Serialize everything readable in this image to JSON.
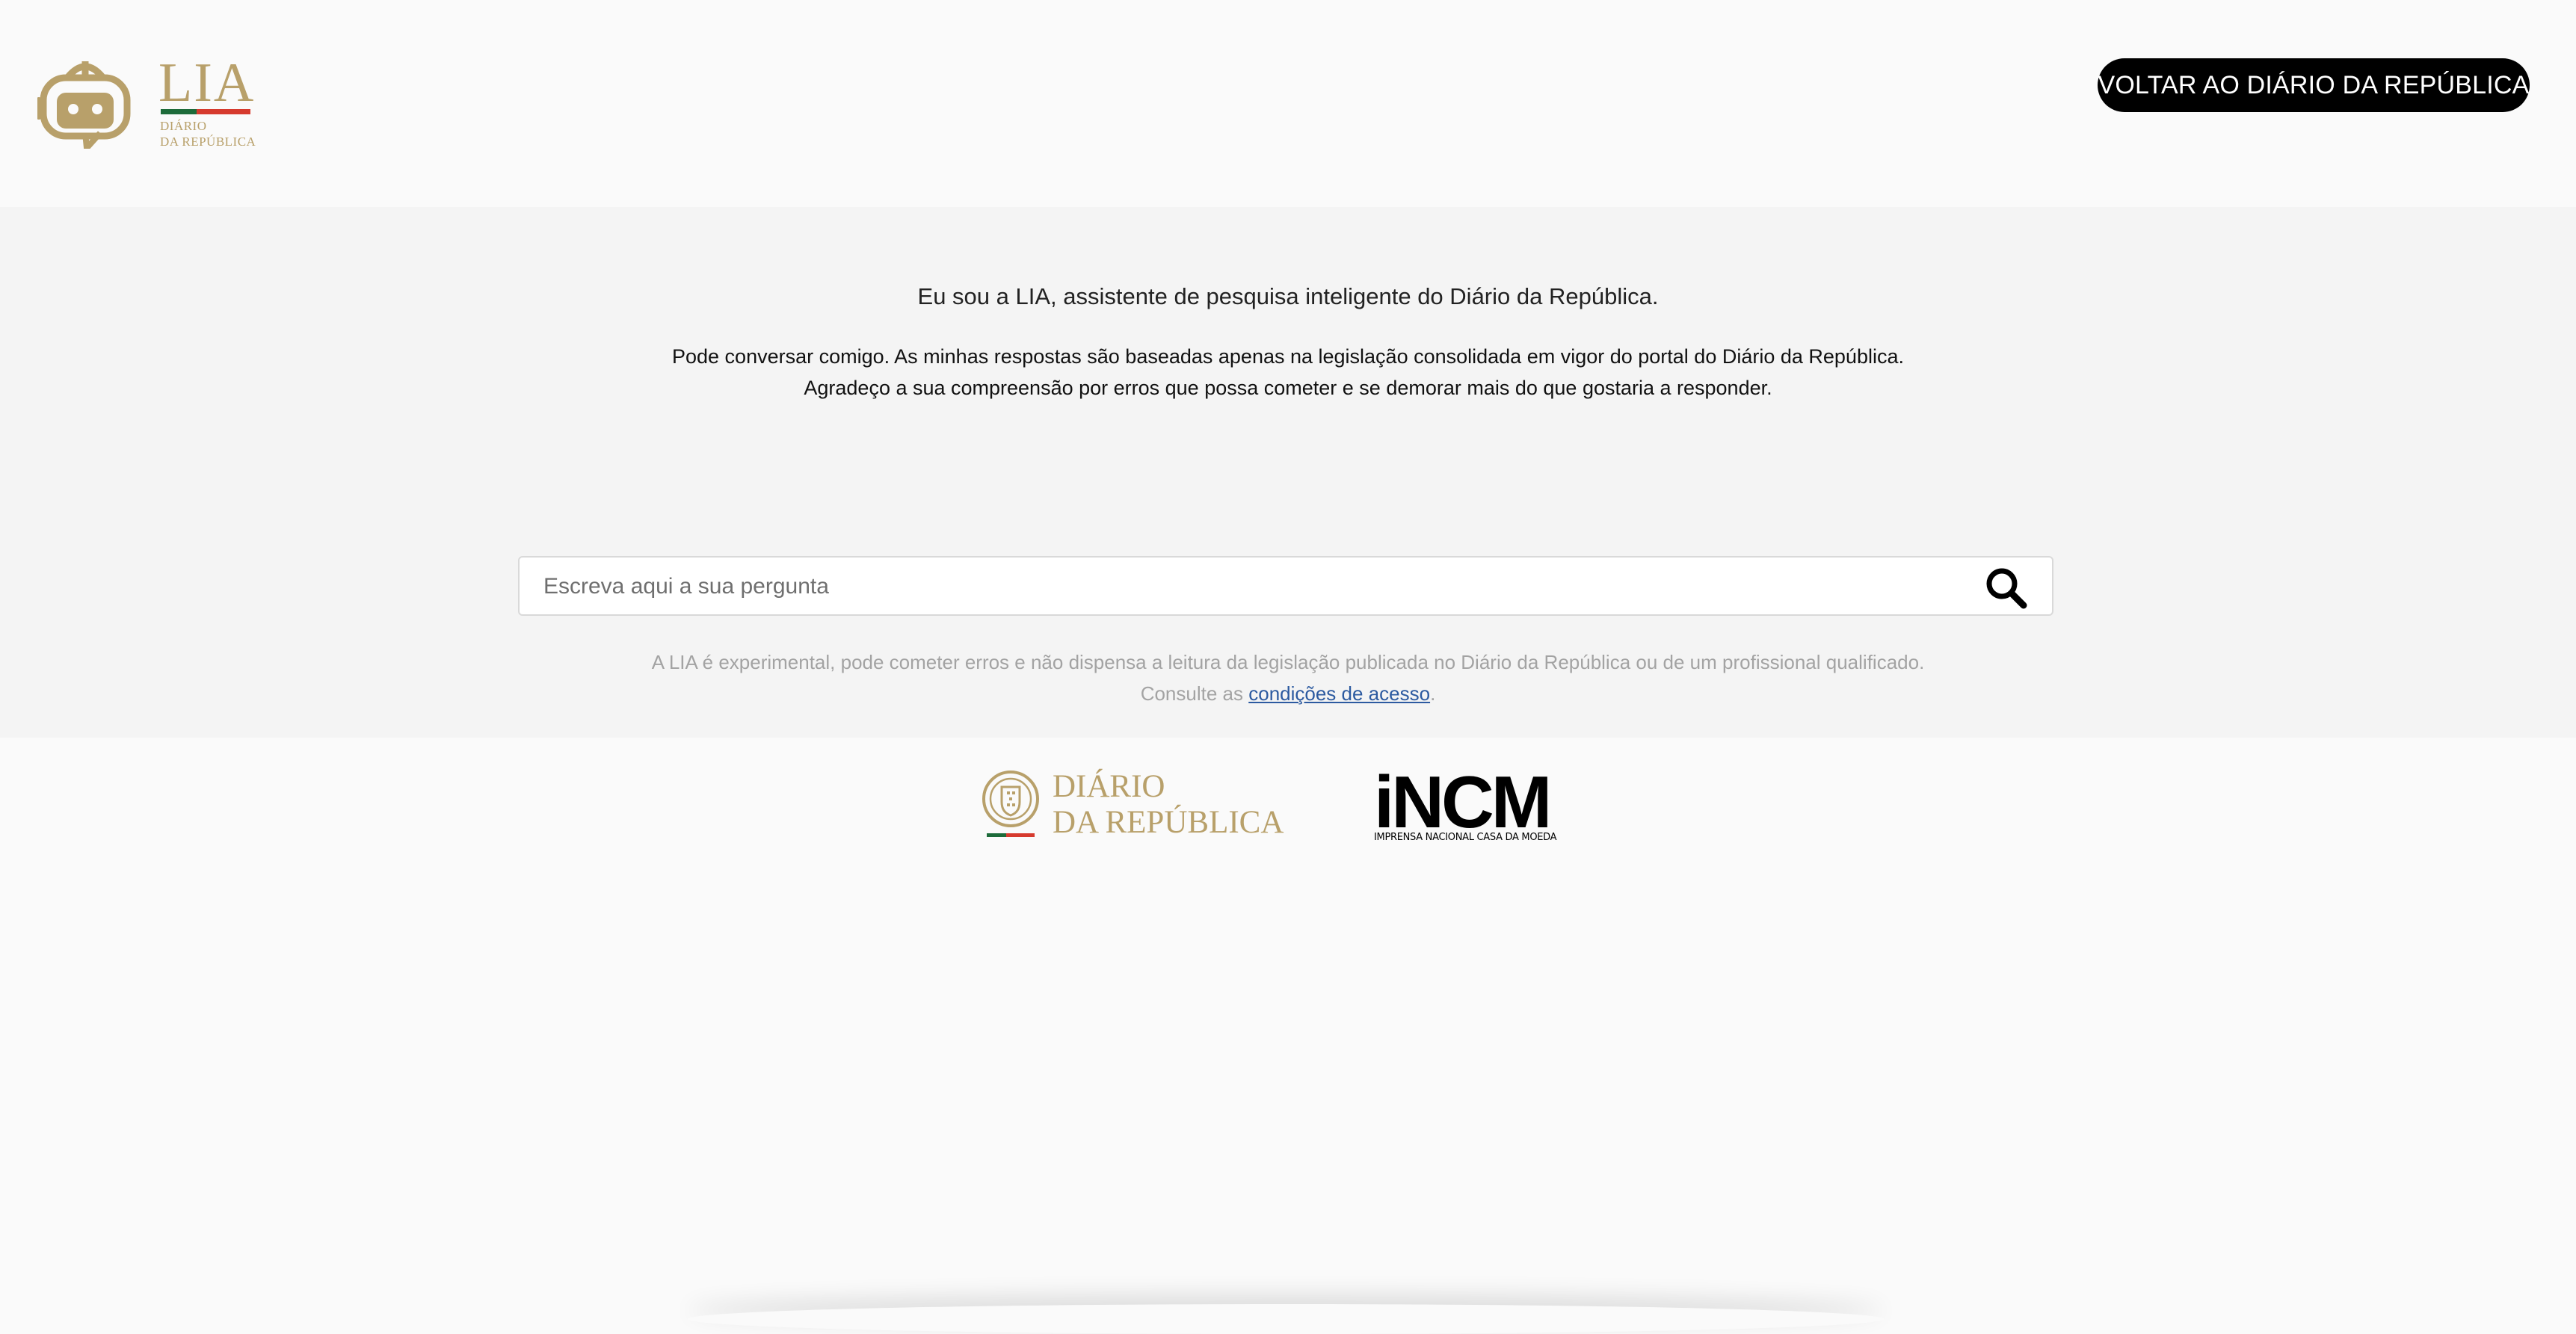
{
  "header": {
    "logo": {
      "name": "LIA",
      "subtitle_line1": "DIÁRIO",
      "subtitle_line2": "DA REPÚBLICA",
      "icon": "robot-chat-icon"
    },
    "back_button_label": "VOLTAR AO DIÁRIO DA REPÚBLICA"
  },
  "intro": {
    "title": "Eu sou a LIA, assistente de pesquisa inteligente do Diário da República.",
    "line1": "Pode conversar comigo. As minhas respostas são baseadas apenas na legislação consolidada em vigor do portal do Diário da República.",
    "line2": "Agradeço a sua compreensão por erros que possa cometer e se demorar mais do que gostaria a responder."
  },
  "search": {
    "placeholder": "Escreva aqui a sua pergunta",
    "value": "",
    "icon": "search-icon"
  },
  "disclaimer": {
    "line1": "A LIA é experimental, pode cometer erros e não dispensa a leitura da legislação publicada no Diário da República ou de um profissional qualificado.",
    "prefix": "Consulte as",
    "link_label": "condições de acesso",
    "suffix": "."
  },
  "footer": {
    "dr_logo": {
      "line1": "DIÁRIO",
      "line2": "DA REPÚBLICA",
      "icon": "coat-of-arms-icon"
    },
    "incm_logo": {
      "mark": "iNCM",
      "subtitle": "IMPRENSA NACIONAL CASA DA MOEDA"
    }
  },
  "colors": {
    "brand_gold": "#b8a06a",
    "flag_green": "#1d6b3a",
    "flag_red": "#d63a2e",
    "link_blue": "#2c5aa0",
    "button_bg": "#000000"
  }
}
